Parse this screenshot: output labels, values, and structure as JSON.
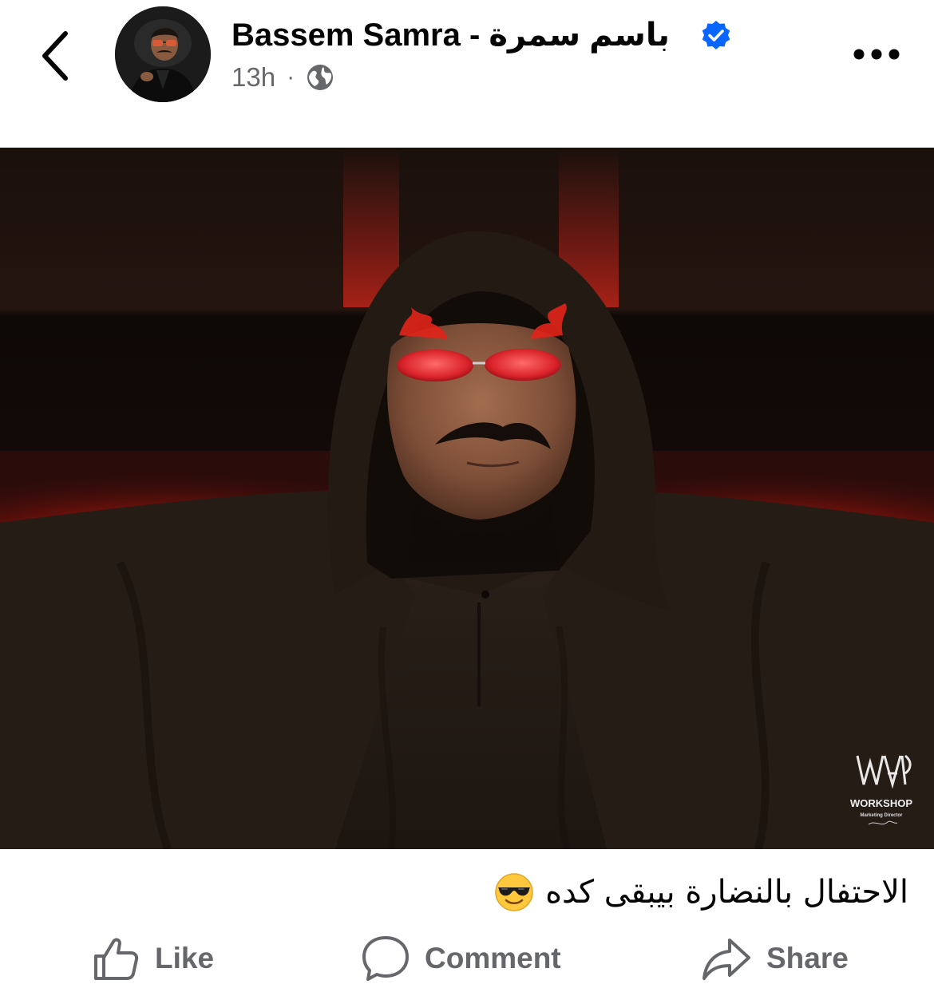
{
  "post": {
    "author_name": "Bassem Samra - باسم سمرة",
    "timestamp": "13h",
    "meta_separator": "·",
    "audience_icon": "globe-icon",
    "verified_icon": "verified-badge-icon",
    "caption_text": "الاحتفال بالنضارة بيبقى كده",
    "caption_emoji": "smiling-face-with-sunglasses",
    "photo_watermark": {
      "brand": "WORKSHOP",
      "subtitle": "Marketing Director"
    }
  },
  "actions": {
    "like_label": "Like",
    "comment_label": "Comment",
    "share_label": "Share"
  },
  "colors": {
    "verified_blue": "#0866ff",
    "secondary_text": "#65676b",
    "primary_text": "#050505",
    "photo_red_glow": "#e2231a"
  },
  "icons": {
    "back": "chevron-left-icon",
    "more": "more-horizontal-icon",
    "like": "thumbs-up-icon",
    "comment": "speech-bubble-icon",
    "share": "share-arrow-icon"
  }
}
